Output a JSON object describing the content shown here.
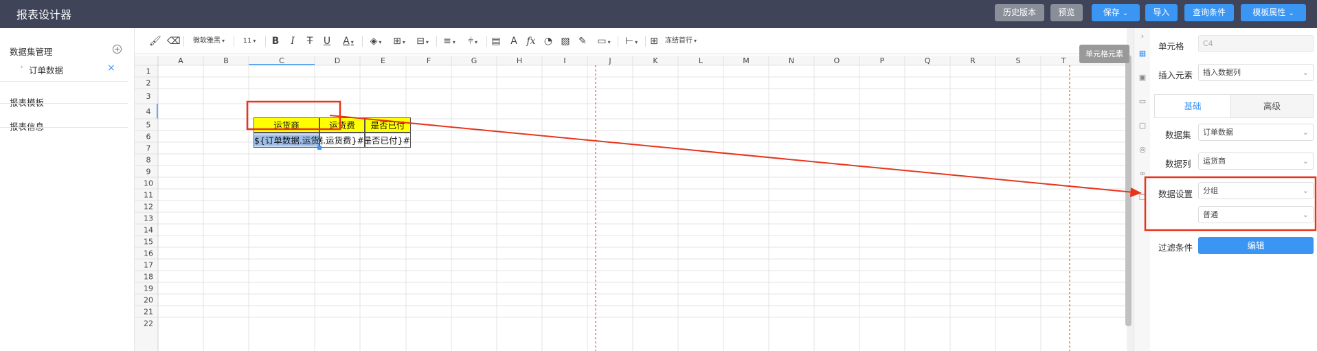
{
  "header": {
    "title": "报表设计器",
    "buttons": [
      {
        "label": "历史版本",
        "style": "gray"
      },
      {
        "label": "预览",
        "style": "gray"
      },
      {
        "label": "保存",
        "style": "blue",
        "dropdown": true
      },
      {
        "label": "导入",
        "style": "blue"
      },
      {
        "label": "查询条件",
        "style": "blue"
      },
      {
        "label": "模板属性",
        "style": "blue",
        "dropdown": true
      }
    ]
  },
  "left_panel": {
    "dataset_manage": "数据集管理",
    "order_data": "订单数据",
    "templates": "报表模板",
    "info": "报表信息"
  },
  "toolbar": {
    "font": "微软雅黑",
    "size": "11",
    "freeze": "冻结首行"
  },
  "grid": {
    "columns": [
      "A",
      "B",
      "C",
      "D",
      "E",
      "F",
      "G",
      "H",
      "I",
      "J",
      "K",
      "L",
      "M",
      "N",
      "O",
      "P",
      "Q",
      "R",
      "S",
      "T"
    ],
    "rows": [
      "1",
      "2",
      "3",
      "4",
      "5",
      "6",
      "7",
      "8",
      "9",
      "10",
      "11",
      "12",
      "13",
      "14",
      "15",
      "16",
      "17",
      "18",
      "19",
      "20",
      "21",
      "22"
    ],
    "header_cells": [
      "运货商",
      "运货费",
      "是否已付"
    ],
    "data_cells": [
      "${订单数据.运货商}",
      "#{订单数据.运货费}",
      "#{订单数据.是否已付}"
    ]
  },
  "tooltip": "单元格元素",
  "props": {
    "cell_label": "单元格",
    "cell_value": "C4",
    "insert_label": "插入元素",
    "insert_value": "插入数据列",
    "tab_basic": "基础",
    "tab_advanced": "高级",
    "dataset_label": "数据集",
    "dataset_value": "订单数据",
    "column_label": "数据列",
    "column_value": "运货商",
    "setting_label": "数据设置",
    "setting_value1": "分组",
    "setting_value2": "普通",
    "filter_label": "过滤条件",
    "edit_button": "编辑"
  },
  "colors": {
    "header_bg": "#3f4458",
    "accent": "#3a95f3",
    "highlight_fill": "#ffff00",
    "annotation_red": "#e8341c"
  }
}
